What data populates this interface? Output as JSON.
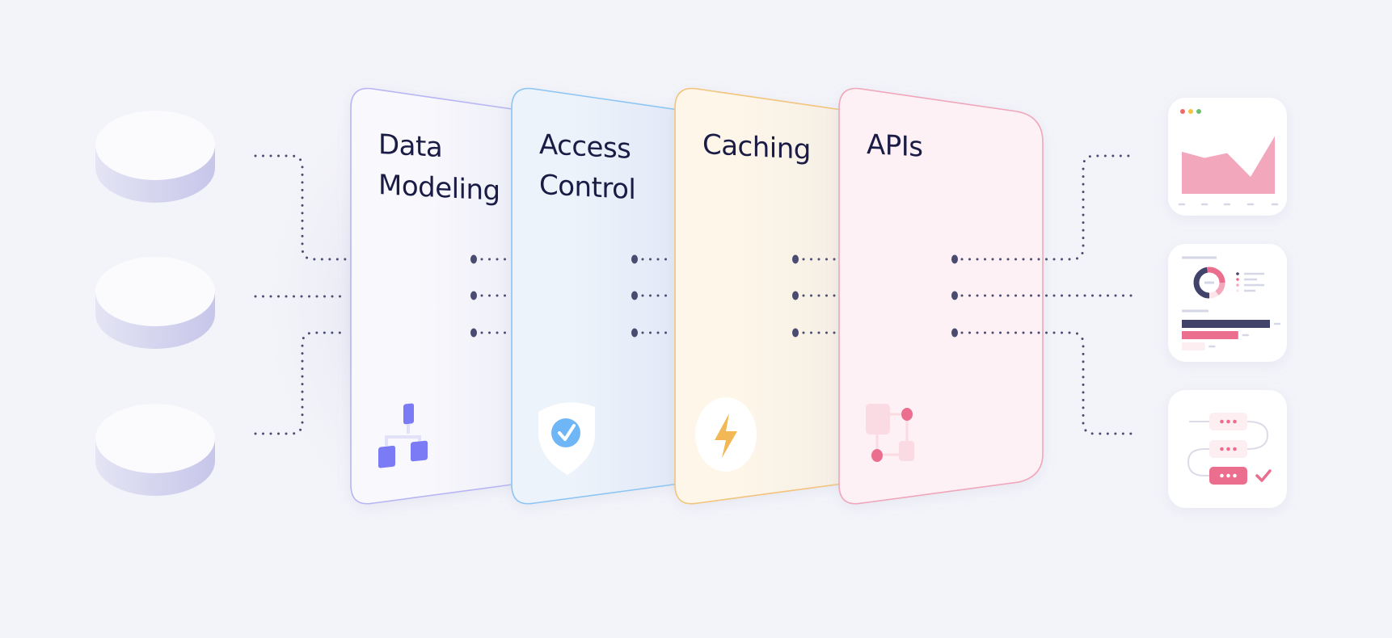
{
  "sources": [
    {
      "name": "data-source-1",
      "icon": "database-cylinder-icon"
    },
    {
      "name": "data-source-2",
      "icon": "database-cylinder-icon"
    },
    {
      "name": "data-source-3",
      "icon": "database-cylinder-icon"
    }
  ],
  "layers": [
    {
      "title_lines": [
        "Data",
        "Modeling"
      ],
      "icon": "hierarchy-icon",
      "accent": "#7b7cf5",
      "border": "#b8b5f4",
      "fill": "#f9f9fd"
    },
    {
      "title_lines": [
        "Access",
        "Control"
      ],
      "icon": "shield-check-icon",
      "accent": "#6fb6f7",
      "border": "#8cc5f3",
      "fill": "#ebf3fb"
    },
    {
      "title_lines": [
        "Caching"
      ],
      "icon": "lightning-bolt-icon",
      "accent": "#f2b855",
      "border": "#f2c47b",
      "fill": "#fdf6ea"
    },
    {
      "title_lines": [
        "APIs"
      ],
      "icon": "api-nodes-icon",
      "accent": "#ec6e8e",
      "border": "#f0a5b9",
      "fill": "#fdf1f5"
    }
  ],
  "outputs": [
    {
      "name": "area-chart-panel",
      "icon": "area-chart-icon",
      "window_dots": [
        "#ee6b6b",
        "#f4c344",
        "#6cc171"
      ],
      "series": [
        0.62,
        0.53,
        0.6,
        0.25,
        0.85
      ]
    },
    {
      "name": "dashboard-panel",
      "icon": "donut-bar-chart-icon",
      "bar_fractions": [
        1.0,
        0.64,
        0.26
      ]
    },
    {
      "name": "workflow-panel",
      "icon": "workflow-check-icon"
    }
  ],
  "colors": {
    "background": "#f3f4f9",
    "text": "#1a1c45",
    "connector": "#4a4b70",
    "navy": "#42436a",
    "pink": "#ec6e8e",
    "light_pink": "#f2a7bd"
  }
}
